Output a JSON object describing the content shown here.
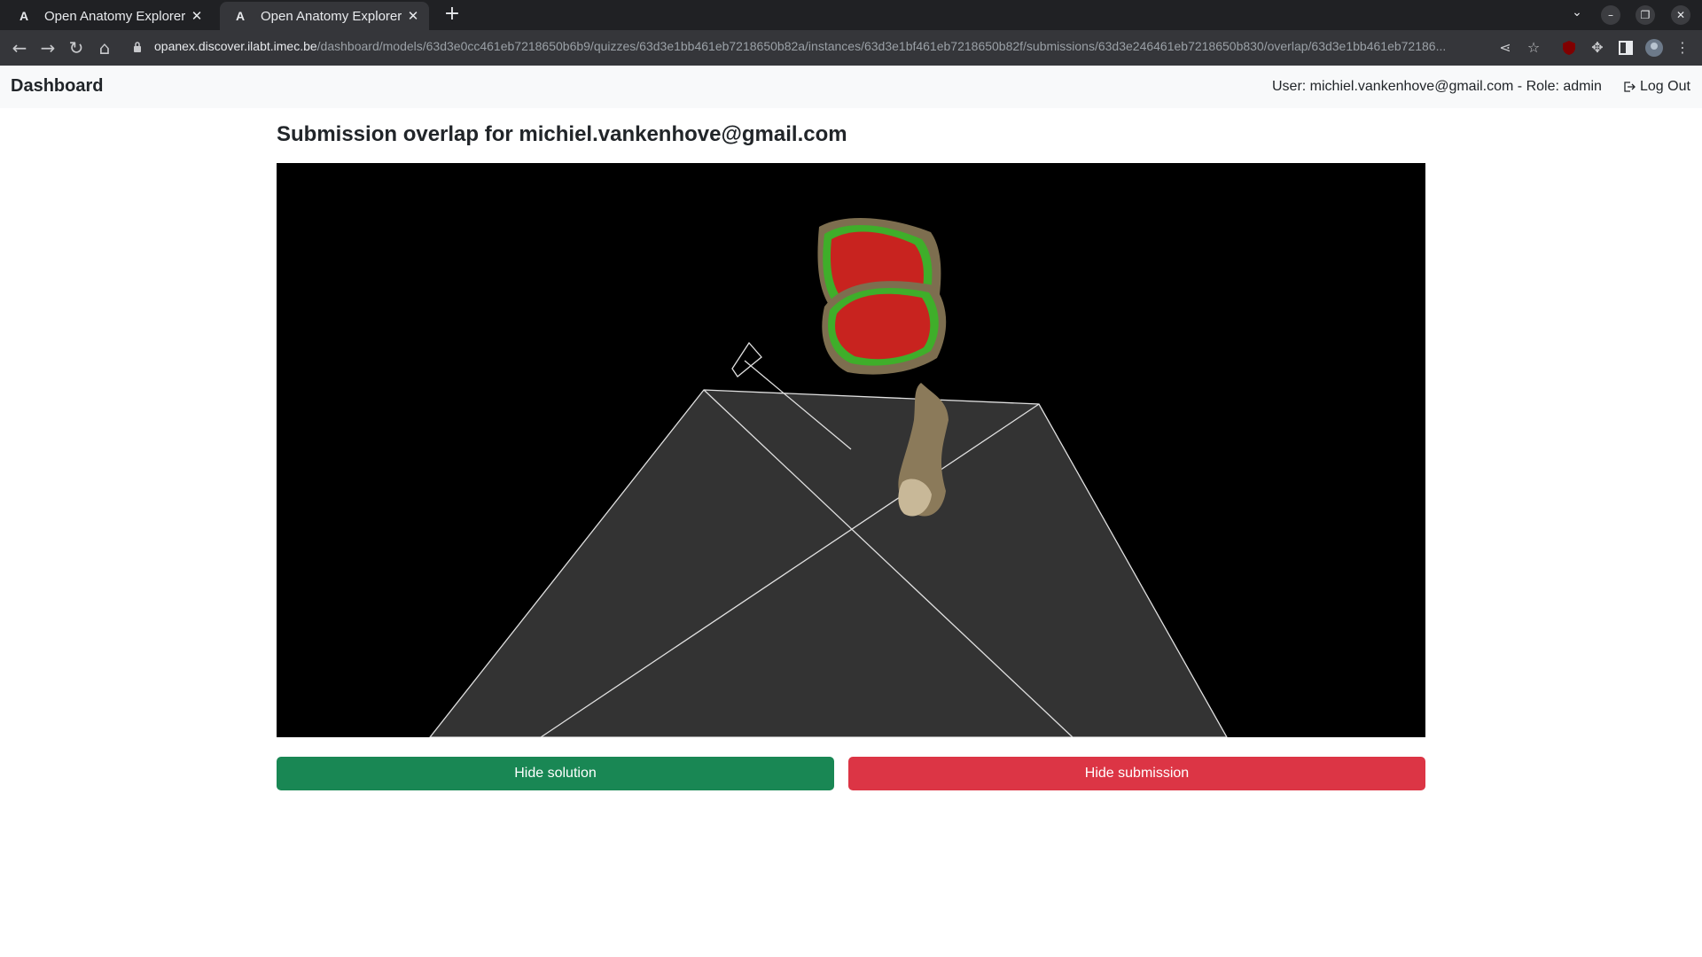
{
  "browser": {
    "tabs": [
      {
        "favicon": "A",
        "title": "Open Anatomy Explorer",
        "close": "✕"
      },
      {
        "favicon": "A",
        "title": "Open Anatomy Explorer",
        "close": "✕"
      }
    ],
    "new_tab": "+",
    "url_host": "opanex.discover.ilabt.imec.be",
    "url_path": "/dashboard/models/63d3e0cc461eb7218650b6b9/quizzes/63d3e1bb461eb7218650b82a/instances/63d3e1bf461eb7218650b82f/submissions/63d3e246461eb7218650b830/overlap/63d3e1bb461eb72186..."
  },
  "navbar": {
    "brand": "Dashboard",
    "user_info": "User: michiel.vankenhove@gmail.com - Role: admin",
    "logout_label": "Log Out"
  },
  "main": {
    "title": "Submission overlap for michiel.vankenhove@gmail.com",
    "hide_solution_label": "Hide solution",
    "hide_submission_label": "Hide submission"
  },
  "colors": {
    "solution": "#198754",
    "submission": "#dc3545",
    "overlap_solution": "#3fae2a",
    "overlap_submission": "#c8231f"
  }
}
